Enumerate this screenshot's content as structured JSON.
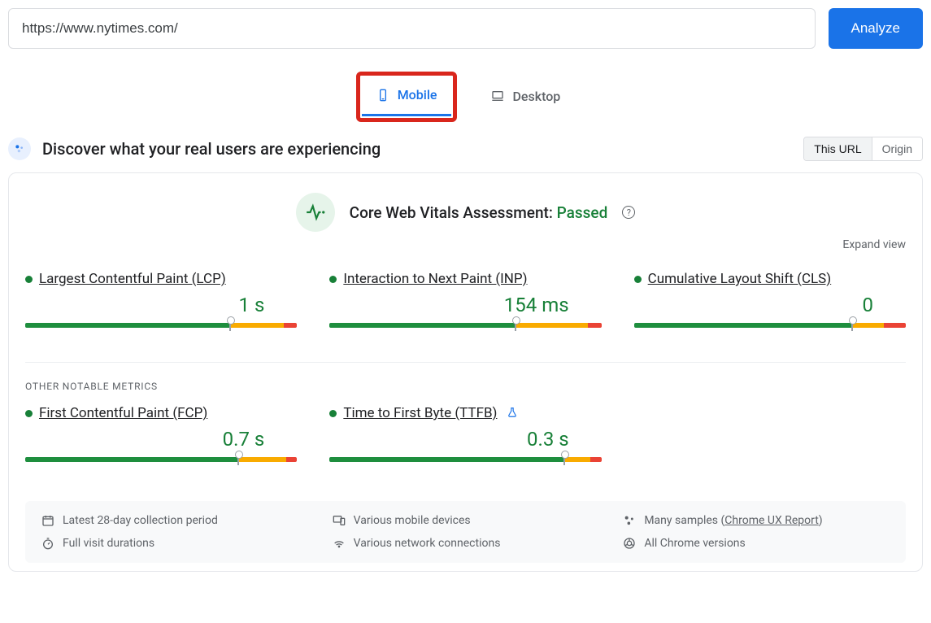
{
  "url_input": {
    "value": "https://www.nytimes.com/"
  },
  "analyze_button": "Analyze",
  "tabs": {
    "mobile": "Mobile",
    "desktop": "Desktop",
    "active": "mobile"
  },
  "section": {
    "title": "Discover what your real users are experiencing",
    "scope": {
      "this_url": "This URL",
      "origin": "Origin",
      "active": "this_url"
    }
  },
  "cwv": {
    "label": "Core Web Vitals Assessment:",
    "status": "Passed",
    "expand": "Expand view"
  },
  "metrics": {
    "lcp": {
      "name": "Largest Contentful Paint (LCP)",
      "value": "1 s",
      "status": "good",
      "segments": [
        75,
        20,
        5
      ],
      "marker": 75
    },
    "inp": {
      "name": "Interaction to Next Paint (INP)",
      "value": "154 ms",
      "status": "good",
      "segments": [
        68,
        27,
        5
      ],
      "marker": 68
    },
    "cls": {
      "name": "Cumulative Layout Shift (CLS)",
      "value": "0",
      "status": "good",
      "segments": [
        80,
        12,
        8
      ],
      "marker": 80
    },
    "fcp": {
      "name": "First Contentful Paint (FCP)",
      "value": "0.7 s",
      "status": "good",
      "segments": [
        78,
        18,
        4
      ],
      "marker": 78
    },
    "ttfb": {
      "name": "Time to First Byte (TTFB)",
      "value": "0.3 s",
      "status": "good",
      "experimental": true,
      "segments": [
        86,
        10,
        4
      ],
      "marker": 86
    }
  },
  "other_metrics_label": "OTHER NOTABLE METRICS",
  "footer": {
    "collection": "Latest 28-day collection period",
    "devices": "Various mobile devices",
    "samples_prefix": "Many samples (",
    "samples_link": "Chrome UX Report",
    "samples_suffix": ")",
    "durations": "Full visit durations",
    "network": "Various network connections",
    "chrome": "All Chrome versions"
  }
}
